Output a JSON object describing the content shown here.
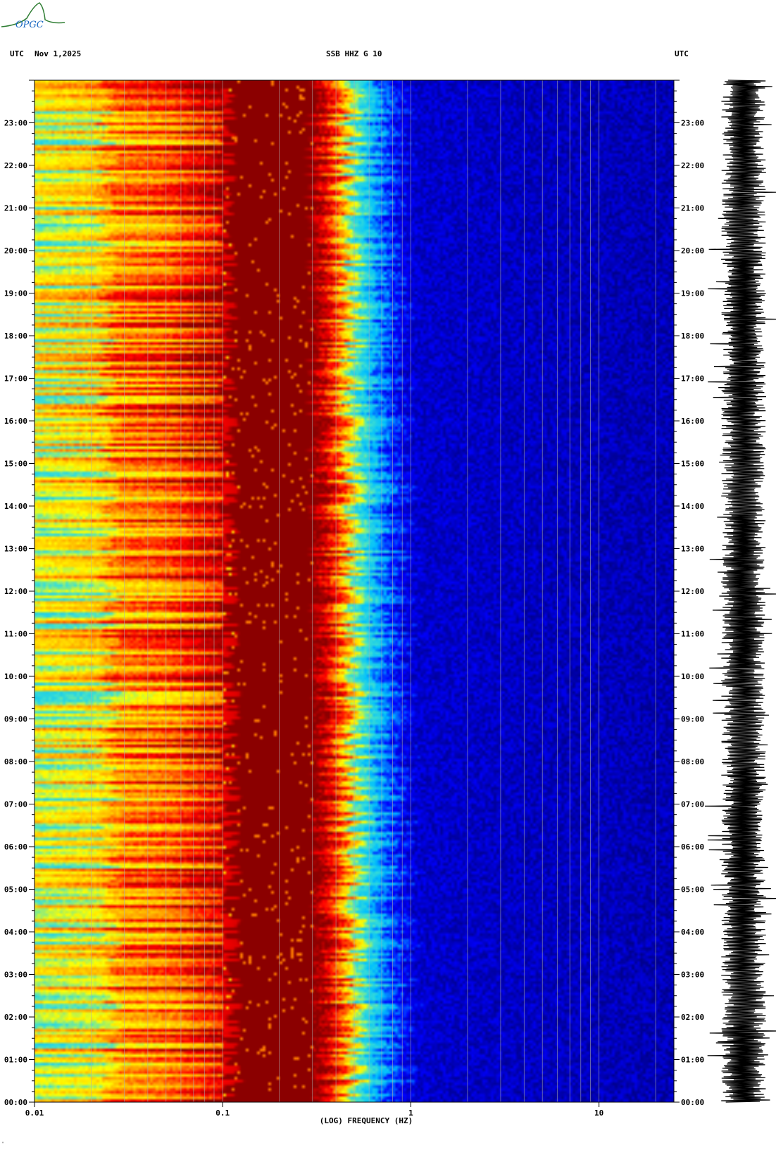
{
  "header": {
    "timezone_left": "UTC",
    "date": "Nov 1,2025",
    "station_title": "SSB HHZ G 10",
    "timezone_right": "UTC"
  },
  "logo": {
    "text": "OPGC",
    "icon": "opgc-logo-icon",
    "color": "#2e7d32",
    "accent": "#1565c0"
  },
  "corner_mark": "\"",
  "chart_data": {
    "type": "heatmap",
    "title": "SSB HHZ G 10",
    "subtitle": "Nov 1,2025",
    "xlabel": "(LOG) FREQUENCY (HZ)",
    "ylabel": "UTC",
    "x_scale": "log",
    "xlim": [
      0.01,
      25
    ],
    "x_ticks": [
      {
        "value": 0.01,
        "label": "0.01"
      },
      {
        "value": 0.1,
        "label": "0.1"
      },
      {
        "value": 1,
        "label": "1"
      },
      {
        "value": 10,
        "label": "10"
      }
    ],
    "ylim_hours": [
      0,
      24
    ],
    "y_ticks": [
      "00:00",
      "01:00",
      "02:00",
      "03:00",
      "04:00",
      "05:00",
      "06:00",
      "07:00",
      "08:00",
      "09:00",
      "10:00",
      "11:00",
      "12:00",
      "13:00",
      "14:00",
      "15:00",
      "16:00",
      "17:00",
      "18:00",
      "19:00",
      "20:00",
      "21:00",
      "22:00",
      "23:00"
    ],
    "colormap": [
      "#00008b",
      "#0000ff",
      "#00bfff",
      "#40e0d0",
      "#ffff00",
      "#ffa500",
      "#ff0000",
      "#8b0000"
    ],
    "intensity_profile": [
      {
        "freq": 0.01,
        "level": 0.55
      },
      {
        "freq": 0.023,
        "level": 0.62
      },
      {
        "freq": 0.025,
        "level": 0.72
      },
      {
        "freq": 0.05,
        "level": 0.76
      },
      {
        "freq": 0.07,
        "level": 0.84
      },
      {
        "freq": 0.1,
        "level": 0.9
      },
      {
        "freq": 0.105,
        "level": 1.0
      },
      {
        "freq": 0.3,
        "level": 1.0
      },
      {
        "freq": 0.4,
        "level": 0.78
      },
      {
        "freq": 0.5,
        "level": 0.45
      },
      {
        "freq": 0.7,
        "level": 0.22
      },
      {
        "freq": 1.0,
        "level": 0.08
      },
      {
        "freq": 25,
        "level": 0.05
      }
    ],
    "side_trace": "seismogram"
  }
}
